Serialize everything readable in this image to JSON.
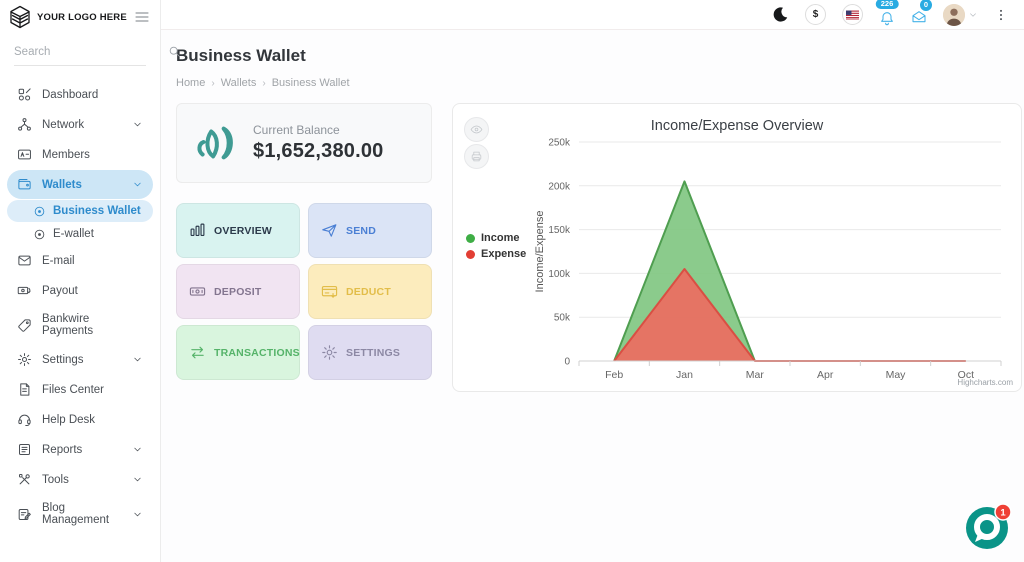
{
  "brand": {
    "name": "YOUR LOGO HERE"
  },
  "sidebar": {
    "search_placeholder": "Search",
    "items": [
      {
        "label": "Dashboard"
      },
      {
        "label": "Network"
      },
      {
        "label": "Members"
      },
      {
        "label": "Wallets"
      },
      {
        "label": "Business Wallet"
      },
      {
        "label": "E-wallet"
      },
      {
        "label": "E-mail"
      },
      {
        "label": "Payout"
      },
      {
        "label": "Bankwire Payments"
      },
      {
        "label": "Settings"
      },
      {
        "label": "Files Center"
      },
      {
        "label": "Help Desk"
      },
      {
        "label": "Reports"
      },
      {
        "label": "Tools"
      },
      {
        "label": "Blog Management"
      }
    ]
  },
  "header": {
    "currency": "$",
    "notification_count": "226",
    "message_count": "0"
  },
  "page": {
    "title": "Business Wallet",
    "breadcrumb_sep": "›",
    "breadcrumb": {
      "home": "Home",
      "section": "Wallets",
      "current": "Business Wallet"
    }
  },
  "balance": {
    "label": "Current Balance",
    "amount": "$1,652,380.00"
  },
  "actions": {
    "overview": "OVERVIEW",
    "send": "SEND",
    "deposit": "DEPOSIT",
    "deduct": "DEDUCT",
    "transactions": "TRANSACTIONS",
    "settings": "SETTINGS"
  },
  "chart_data": {
    "type": "area",
    "title": "Income/Expense Overview",
    "ylabel": "Income/Expense",
    "categories": [
      "Feb",
      "Jan",
      "Mar",
      "Apr",
      "May",
      "Oct"
    ],
    "series": [
      {
        "name": "Income",
        "line": "#4f9e50",
        "fill": "#7ec57f",
        "marker": "#3fae46",
        "values": [
          0,
          205000,
          0,
          null,
          null,
          null
        ]
      },
      {
        "name": "Expense",
        "line": "#d94f43",
        "fill": "#ee6a5f",
        "marker": "#e23e34",
        "values": [
          0,
          105000,
          0,
          0,
          0,
          0
        ]
      }
    ],
    "ylim": [
      0,
      250000
    ],
    "yticks": [
      0,
      50000,
      100000,
      150000,
      200000,
      250000
    ],
    "ytick_labels": [
      "0",
      "50k",
      "100k",
      "150k",
      "200k",
      "250k"
    ],
    "grid": true,
    "legend_position": "left",
    "credit": "Highcharts.com"
  },
  "chat": {
    "unread": "1"
  },
  "colors": {
    "accent": "#2e8bcc",
    "pill": "#cde6f6",
    "subpill": "#ddedf9",
    "badge": "#29abe2",
    "chat": "#0a9488",
    "alert": "#ef4036"
  }
}
